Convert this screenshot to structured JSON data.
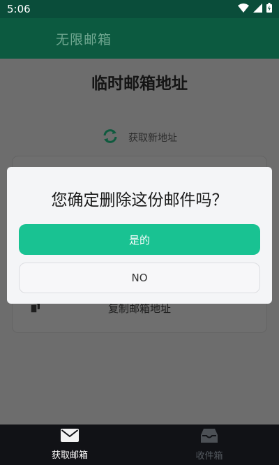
{
  "status_bar": {
    "time": "5:06"
  },
  "app_bar": {
    "title": "无限邮箱"
  },
  "main": {
    "title": "临时邮箱地址",
    "refresh_label": "获取新地址",
    "copy_label": "复制邮箱地址"
  },
  "dialog": {
    "message": "您确定删除这份邮件吗？",
    "yes_label": "是的",
    "no_label": "NO"
  },
  "bottom_nav": {
    "items": [
      {
        "label": "获取邮箱",
        "icon": "mail-icon",
        "active": true
      },
      {
        "label": "收件箱",
        "icon": "inbox-icon",
        "active": false
      }
    ]
  },
  "colors": {
    "accent": "#19c292",
    "app_bar": "#0c5a40",
    "status_bar": "#0a4d3a",
    "nav_bg": "#111216"
  }
}
